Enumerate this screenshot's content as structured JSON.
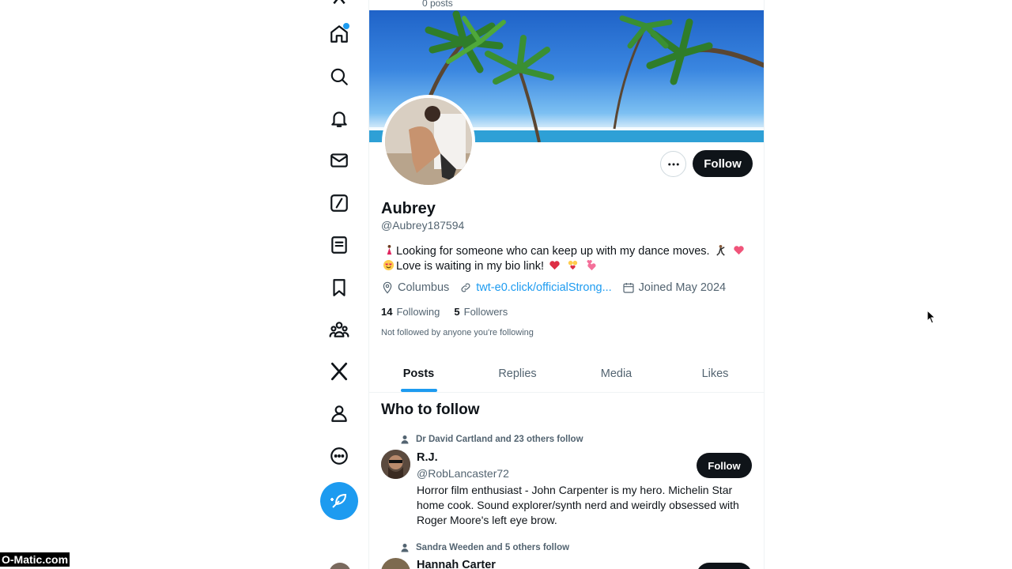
{
  "nav": {
    "items": [
      {
        "name": "home",
        "icon": "home-icon",
        "has_badge": true
      },
      {
        "name": "explore",
        "icon": "search-icon"
      },
      {
        "name": "notifications",
        "icon": "bell-icon"
      },
      {
        "name": "messages",
        "icon": "envelope-icon"
      },
      {
        "name": "grok",
        "icon": "grok-icon"
      },
      {
        "name": "lists",
        "icon": "list-icon"
      },
      {
        "name": "bookmarks",
        "icon": "bookmark-icon"
      },
      {
        "name": "communities",
        "icon": "communities-icon"
      },
      {
        "name": "premium",
        "icon": "x-logo-icon"
      },
      {
        "name": "profile",
        "icon": "person-icon"
      },
      {
        "name": "more",
        "icon": "more-circle-icon"
      }
    ],
    "post_button_icon": "feather-icon",
    "accent": "#1d9bf0"
  },
  "header": {
    "posts_count": "0 posts"
  },
  "profile": {
    "name": "Aubrey",
    "handle": "@Aubrey187594",
    "bio_line1": "Looking for someone who can keep up with my dance moves.",
    "bio_line2": "Love is waiting in my bio link!",
    "location": "Columbus",
    "link": "twt-e0.click/officialStrong...",
    "joined": "Joined May 2024",
    "following_count": "14",
    "following_label": "Following",
    "followers_count": "5",
    "followers_label": "Followers",
    "not_followed": "Not followed by anyone you're following",
    "follow_label": "Follow"
  },
  "tabs": [
    "Posts",
    "Replies",
    "Media",
    "Likes"
  ],
  "who_to_follow": {
    "title": "Who to follow",
    "suggestions": [
      {
        "social": "Dr David Cartland and 23 others follow",
        "name": "R.J.",
        "handle": "@RobLancaster72",
        "bio": "Horror film enthusiast - John Carpenter is my hero. Michelin Star home cook. Sound explorer/synth nerd and weirdly obsessed with Roger Moore's left eye brow.",
        "follow_label": "Follow"
      },
      {
        "social": "Sandra Weeden and 5 others follow",
        "name": "Hannah Carter",
        "follow_label": "Follow"
      }
    ]
  },
  "watermark": "O-Matic.com"
}
